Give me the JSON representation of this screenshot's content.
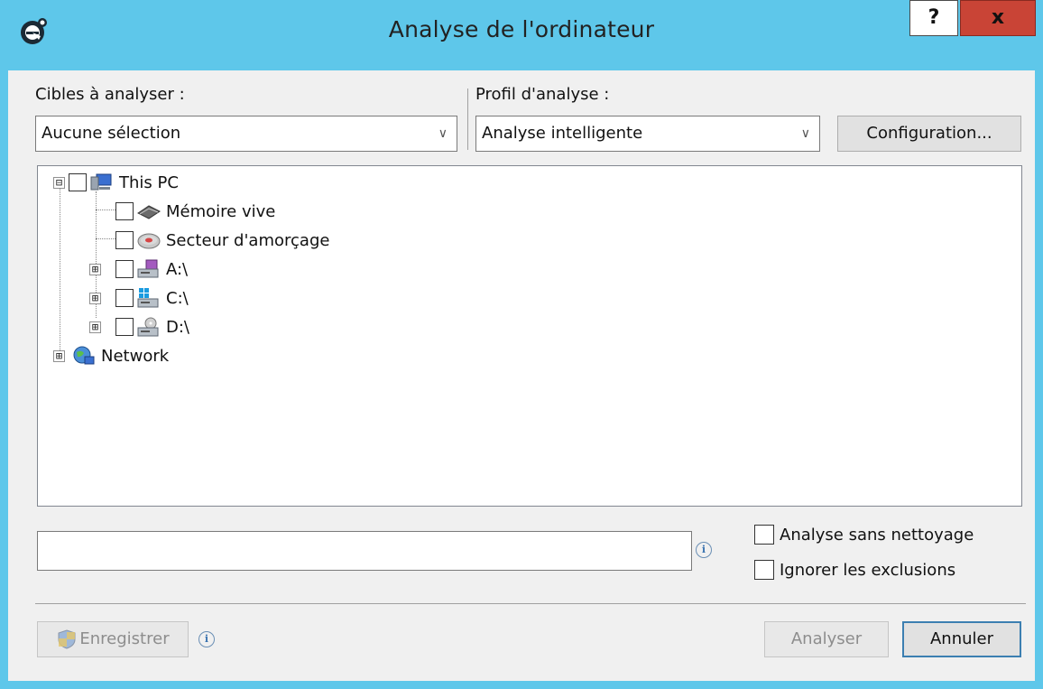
{
  "window": {
    "title": "Analyse de l'ordinateur",
    "help_label": "?",
    "close_label": "x",
    "logo_icon": "eset-e-logo-icon"
  },
  "targets": {
    "label": "Cibles à analyser :",
    "selected": "Aucune sélection"
  },
  "profile": {
    "label": "Profil d'analyse :",
    "selected": "Analyse intelligente",
    "config_label": "Configuration..."
  },
  "tree": {
    "items": [
      {
        "label": "This PC",
        "icon": "computer-icon",
        "expander": "⊟"
      },
      {
        "label": "Mémoire vive",
        "icon": "memory-chip-icon"
      },
      {
        "label": "Secteur d'amorçage",
        "icon": "boot-sector-disk-icon"
      },
      {
        "label": "A:\\",
        "icon": "floppy-drive-icon",
        "expander": "⊞"
      },
      {
        "label": "C:\\",
        "icon": "system-drive-icon",
        "expander": "⊞"
      },
      {
        "label": "D:\\",
        "icon": "optical-drive-icon",
        "expander": "⊞"
      },
      {
        "label": "Network",
        "icon": "network-globe-icon",
        "expander": "⊞"
      }
    ]
  },
  "options": {
    "no_clean_label": "Analyse sans nettoyage",
    "ignore_exclusions_label": "Ignorer les exclusions"
  },
  "footer": {
    "save_label": "Enregistrer",
    "scan_label": "Analyser",
    "cancel_label": "Annuler"
  },
  "colors": {
    "titlebar": "#5ec7ea",
    "close": "#c94436",
    "client": "#f0f0f0"
  }
}
